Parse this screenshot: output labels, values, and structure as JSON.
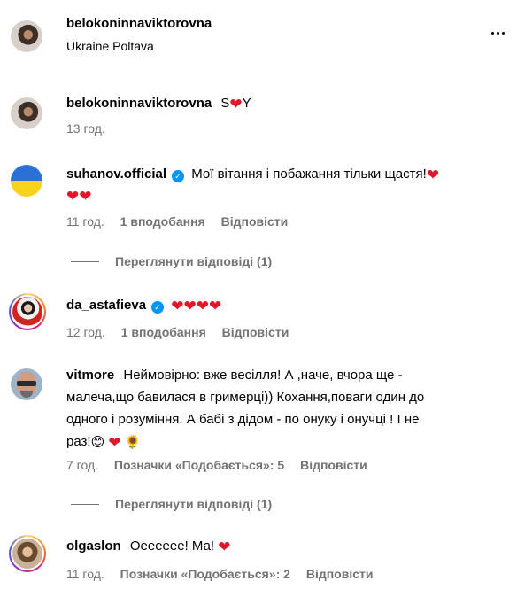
{
  "post_header": {
    "username": "belokoninnaviktorovna",
    "location": "Ukraine Poltava"
  },
  "caption": {
    "username": "belokoninnaviktorovna",
    "text_before": "S",
    "text_after": "Y",
    "time": "13 год."
  },
  "comments": [
    {
      "username": "suhanov.official",
      "verified": true,
      "text": "Мої вітання і побажання тільки щастя!",
      "time": "11 год.",
      "likes": "1 вподобання",
      "reply": "Відповісти",
      "view_replies": "Переглянути відповіді (1)"
    },
    {
      "username": "da_astafieva",
      "verified": true,
      "text": "",
      "time": "12 год.",
      "likes": "1 вподобання",
      "reply": "Відповісти"
    },
    {
      "username": "vitmore",
      "verified": false,
      "text_line1": "Неймовірно: вже весілля! А ,наче, вчора ще -",
      "text_line2": "малеча,що бавилася в гримерці)) Кохання,поваги один до",
      "text_line3": "одного і розуміння. А бабі з дідом - по онуку і онучці ! І не",
      "text_line4": "раз!",
      "time": "7 год.",
      "likes": "Позначки «Подобається»: 5",
      "reply": "Відповісти",
      "view_replies": "Переглянути відповіді (1)"
    },
    {
      "username": "olgaslon",
      "verified": false,
      "text": "Оееееее! Ма!",
      "time": "11 год.",
      "likes": "Позначки «Подобається»: 2",
      "reply": "Відповісти"
    }
  ],
  "icons": {
    "heart": "❤",
    "verified": "✓",
    "smile": "😊",
    "sunflower": "🌻"
  },
  "colors": {
    "heart": "#e0162b",
    "verified": "#0095f6",
    "secondary_text": "#737373"
  }
}
